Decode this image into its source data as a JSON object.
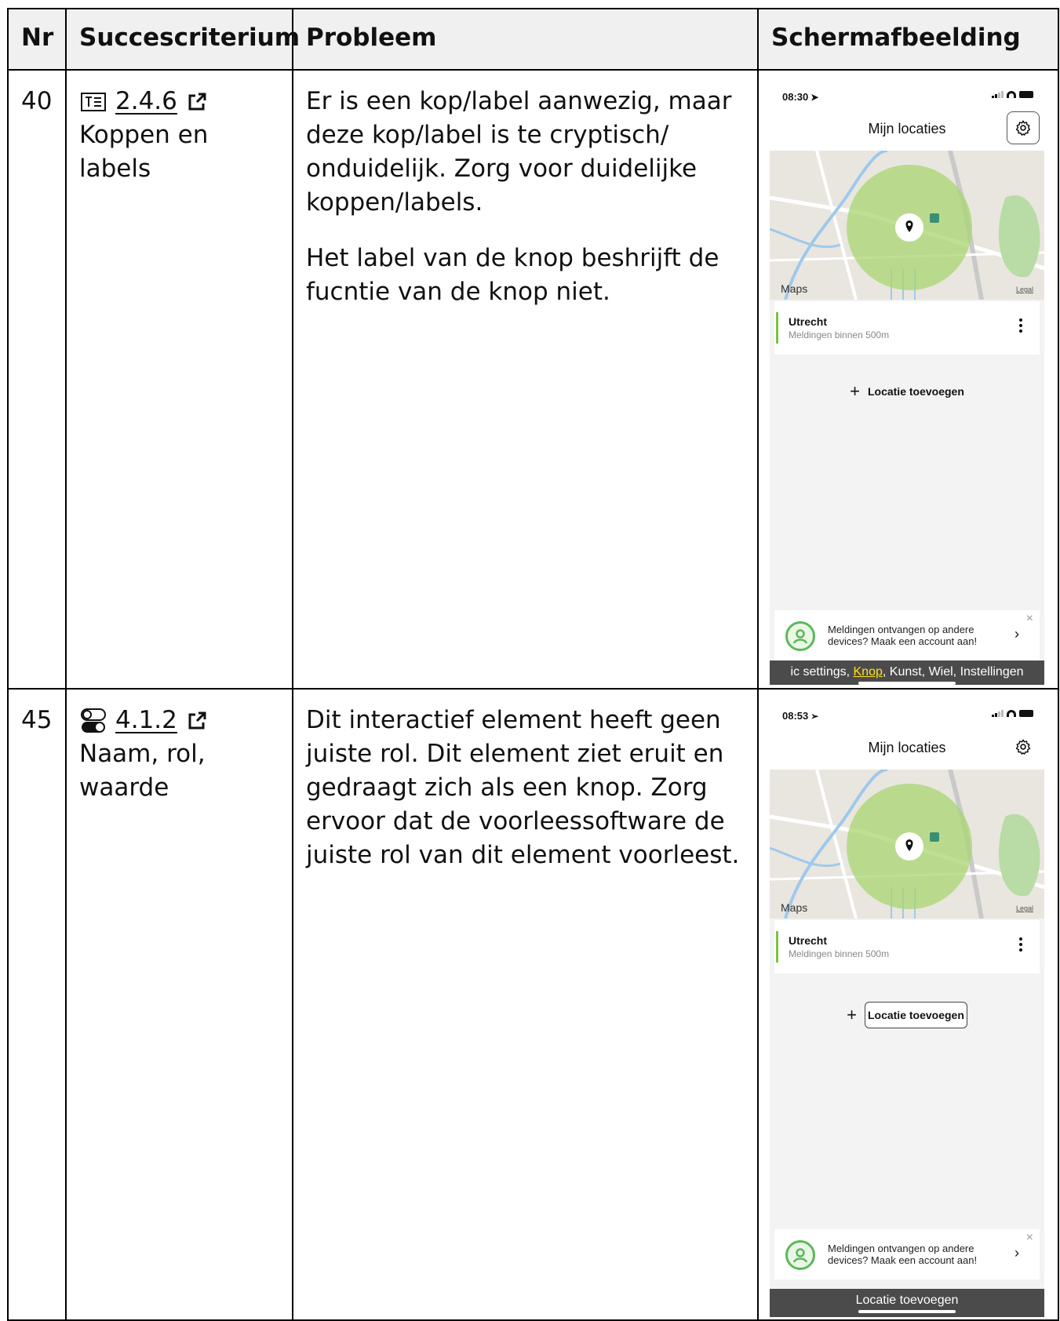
{
  "table": {
    "headers": {
      "nr": "Nr",
      "criterion": "Succescriterium",
      "problem": "Probleem",
      "screenshot": "Schermafbeelding"
    },
    "rows": [
      {
        "nr": "40",
        "criterion_icon": "text-heading-icon",
        "criterion_code": "2.4.6",
        "criterion_name": "Koppen en labels",
        "problem_paragraphs": [
          "Er is een kop/label aanwezig, maar deze kop/label is te cryptisch/ onduidelijk. Zorg voor duidelijke koppen/labels.",
          "Het label van de knop beshrijft de fucntie van de knop niet."
        ],
        "screenshot": {
          "time": "08:30",
          "app_title": "Mijn locaties",
          "maps_label": "Maps",
          "legal_label": "Legal",
          "location_name": "Utrecht",
          "location_sub": "Meldingen binnen 500m",
          "add_plus": "+",
          "add_label": "Locatie toevoegen",
          "promo_line1": "Meldingen ontvangen op andere",
          "promo_line2": "devices? Maak een account aan!",
          "promo_close": "×",
          "promo_chevron": "›",
          "voiceover_prefix": "ic settings, ",
          "voiceover_highlight": "Knop",
          "voiceover_suffix": ", Kunst, Wiel, Instellingen",
          "gear_focused": true
        }
      },
      {
        "nr": "45",
        "criterion_icon": "toggle-switch-icon",
        "criterion_code": "4.1.2",
        "criterion_name": "Naam, rol, waarde",
        "problem_paragraphs": [
          "Dit interactief element heeft geen juiste rol. Dit element ziet eruit en gedraagt zich als een knop. Zorg ervoor dat de voorleessoftware de juiste rol van dit element voorleest."
        ],
        "screenshot": {
          "time": "08:53",
          "app_title": "Mijn locaties",
          "maps_label": "Maps",
          "legal_label": "Legal",
          "location_name": "Utrecht",
          "location_sub": "Meldingen binnen 500m",
          "add_plus": "+",
          "add_label": "Locatie toevoegen",
          "promo_line1": "Meldingen ontvangen op andere",
          "promo_line2": "devices? Maak een account aan!",
          "promo_close": "×",
          "promo_chevron": "›",
          "voiceover_text": "Locatie toevoegen",
          "add_button_focused": true
        }
      }
    ]
  },
  "colors": {
    "accent_green": "#7cc242",
    "map_circle": "#a8d672",
    "voiceover_bar": "#4b4b4b",
    "voiceover_highlight": "#ffe11a"
  }
}
